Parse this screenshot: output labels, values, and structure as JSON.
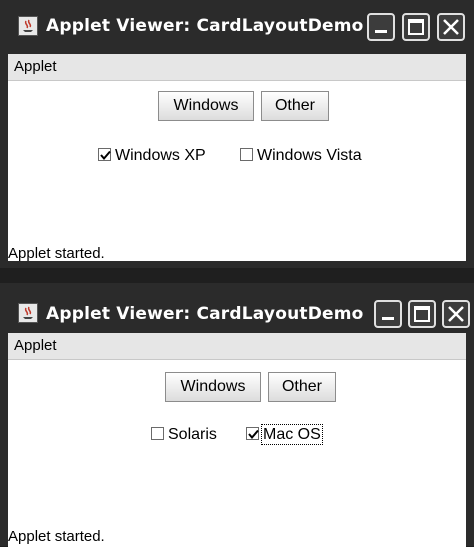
{
  "windows": [
    {
      "title": "Applet Viewer: CardLayoutDemo",
      "menu": [
        "Applet"
      ],
      "buttons": {
        "windows": "Windows",
        "other": "Other"
      },
      "checkboxes": [
        {
          "label": "Windows XP",
          "checked": true
        },
        {
          "label": "Windows Vista",
          "checked": false
        }
      ],
      "status": "Applet started."
    },
    {
      "title": "Applet Viewer: CardLayoutDemo",
      "menu": [
        "Applet"
      ],
      "buttons": {
        "windows": "Windows",
        "other": "Other"
      },
      "checkboxes": [
        {
          "label": "Solaris",
          "checked": false
        },
        {
          "label": "Mac OS",
          "checked": true
        }
      ],
      "status": "Applet started."
    }
  ],
  "icons": {
    "app": "java-applet-icon",
    "minimize": "minimize-icon",
    "maximize": "maximize-icon",
    "close": "close-icon",
    "check": "checkmark-icon"
  },
  "colors": {
    "titlebar": "#2b2b2b",
    "menubar": "#e6e6e6",
    "content": "#ffffff"
  }
}
